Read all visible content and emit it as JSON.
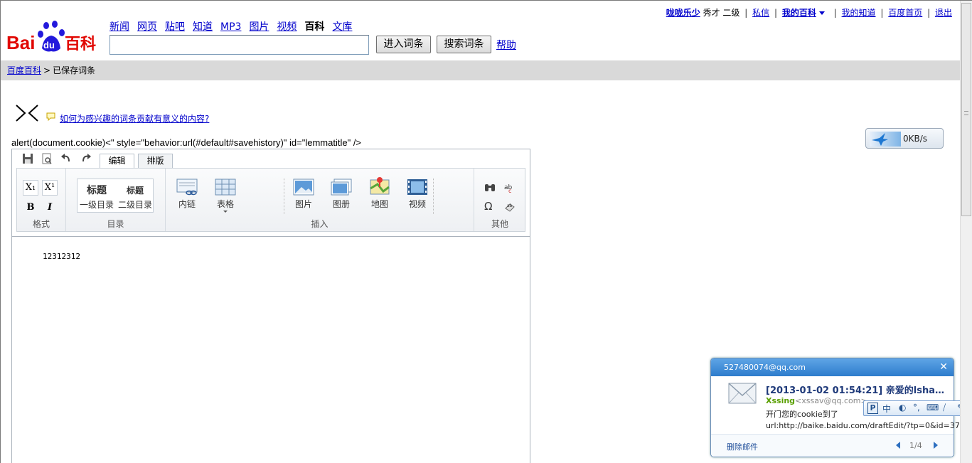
{
  "top_links": {
    "username": "咙咙乐少",
    "rank": "秀才 二级",
    "sep": "|",
    "messages": "私信",
    "my_baike": "我的百科",
    "my_zhidao": "我的知道",
    "baidu_home": "百度首页",
    "logout": "退出"
  },
  "logo": {
    "text_bai": "Bai",
    "text_du": "du",
    "text_baike": "百科"
  },
  "nav": {
    "items": [
      "新闻",
      "网页",
      "贴吧",
      "知道",
      "MP3",
      "图片",
      "视频"
    ],
    "current": "百科",
    "last": "文库"
  },
  "search": {
    "value": "",
    "enter_label": "进入词条",
    "search_label": "搜索词条",
    "help": "帮助"
  },
  "breadcrumb": {
    "home": "百度百科",
    "sep": ">",
    "current": "已保存词条"
  },
  "tip": {
    "link": "如何为感兴趣的词条贡献有意义的内容?"
  },
  "injected_text": "alert(document.cookie)<\" style=\"behavior:url(#default#savehistory)\" id=\"lemmatitle\" />",
  "speed": {
    "value": "0KB/s"
  },
  "editor": {
    "tabs": [
      "编辑",
      "排版"
    ],
    "groups": {
      "format": "格式",
      "toc": "目录",
      "insert": "插入",
      "other": "其他"
    },
    "toc": {
      "h1": "标题",
      "h1_sub": "一级目录",
      "h2": "标题",
      "h2_sub": "二级目录"
    },
    "insert": {
      "inner_link": "内链",
      "table": "表格",
      "image": "图片",
      "album": "图册",
      "map": "地图",
      "video": "视频"
    },
    "format": {
      "sub": "X₁",
      "sup": "X¹",
      "bold": "B",
      "italic": "I"
    },
    "content": "12312312"
  },
  "mail": {
    "account": "527480074@qq.com",
    "close": "✕",
    "subject": "[2013-01-02 01:54:21] 亲爱的lsha…",
    "from_name": "Xssing",
    "from_email": "<xssav@qq.com>",
    "body": "开门您的cookie到了",
    "url": "url:http://baike.baidu.com/draftEdit/?tp=0&id=37…",
    "delete": "删除邮件",
    "page": "1/4"
  },
  "ime": {
    "mode": "中"
  }
}
